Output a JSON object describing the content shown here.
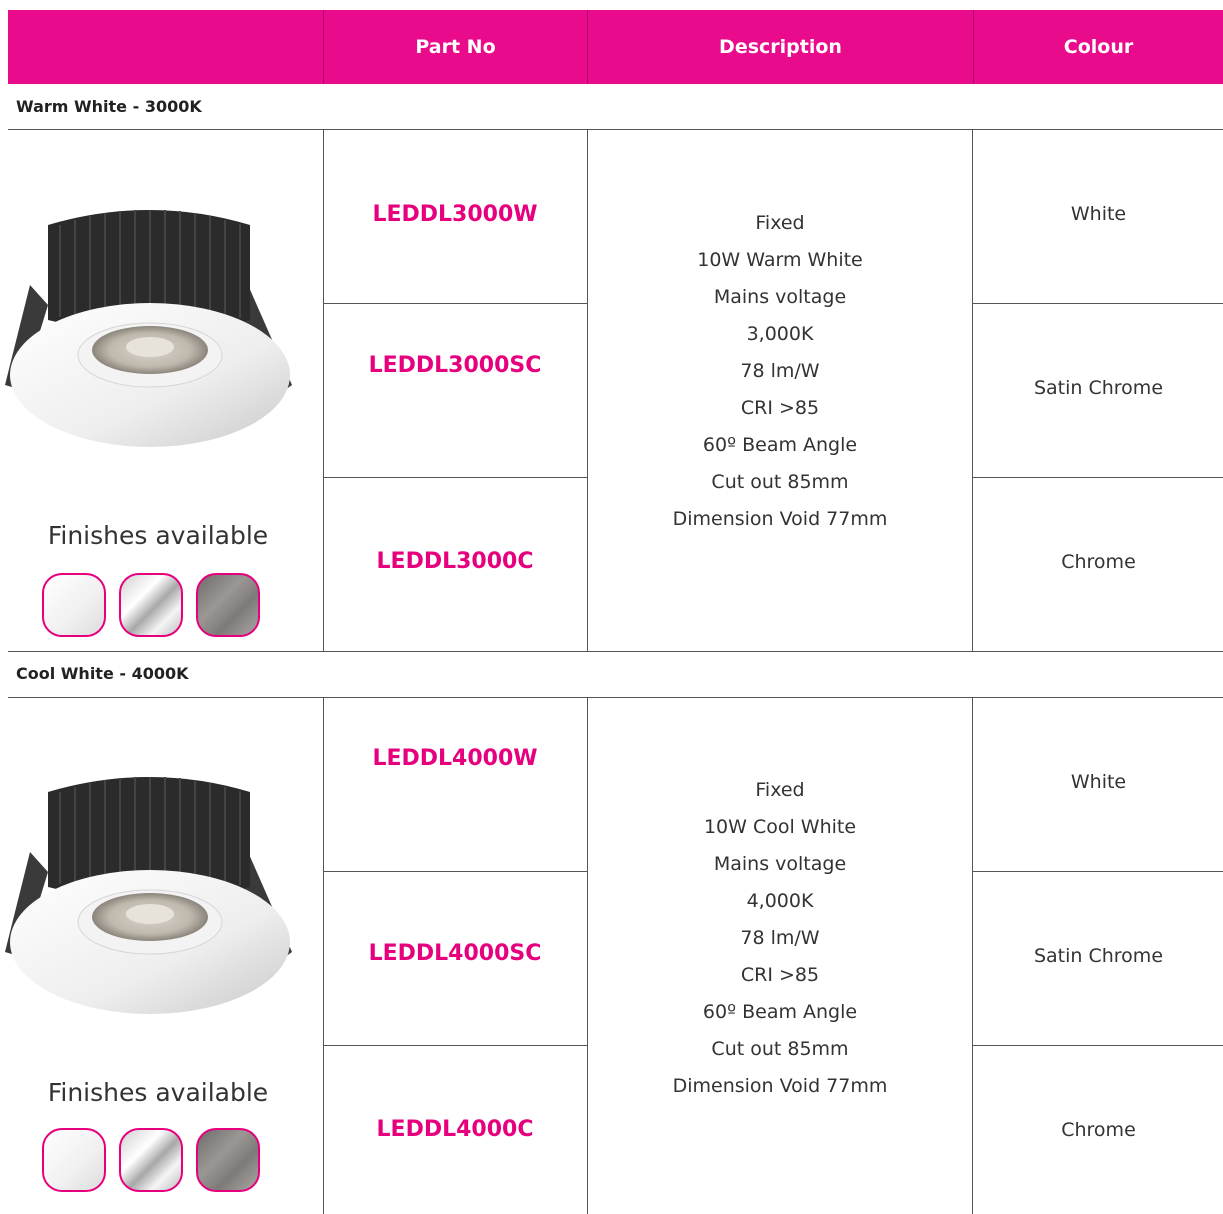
{
  "header": {
    "col1": "",
    "part_no": "Part No",
    "description": "Description",
    "colour": "Colour"
  },
  "accent_color": "#ea0a8c",
  "sections": [
    {
      "title": "Warm White - 3000K",
      "finishes_label": "Finishes available",
      "finishes": [
        "white",
        "chrome",
        "satin-chrome"
      ],
      "rows": [
        {
          "part_no": "LEDDL3000W",
          "colour": "White"
        },
        {
          "part_no": "LEDDL3000SC",
          "colour": "Satin Chrome"
        },
        {
          "part_no": "LEDDL3000C",
          "colour": "Chrome"
        }
      ],
      "description": [
        "Fixed",
        "10W Warm White",
        "Mains voltage",
        "3,000K",
        "78 lm/W",
        "CRI >85",
        "60º Beam Angle",
        "Cut out 85mm",
        "Dimension Void 77mm"
      ]
    },
    {
      "title": "Cool White - 4000K",
      "finishes_label": "Finishes available",
      "finishes": [
        "white",
        "chrome",
        "satin-chrome"
      ],
      "rows": [
        {
          "part_no": "LEDDL4000W",
          "colour": "White"
        },
        {
          "part_no": "LEDDL4000SC",
          "colour": "Satin Chrome"
        },
        {
          "part_no": "LEDDL4000C",
          "colour": "Chrome"
        }
      ],
      "description": [
        "Fixed",
        "10W Cool White",
        "Mains voltage",
        "4,000K",
        "78 lm/W",
        "CRI >85",
        "60º Beam Angle",
        "Cut out 85mm",
        "Dimension Void 77mm"
      ]
    }
  ]
}
